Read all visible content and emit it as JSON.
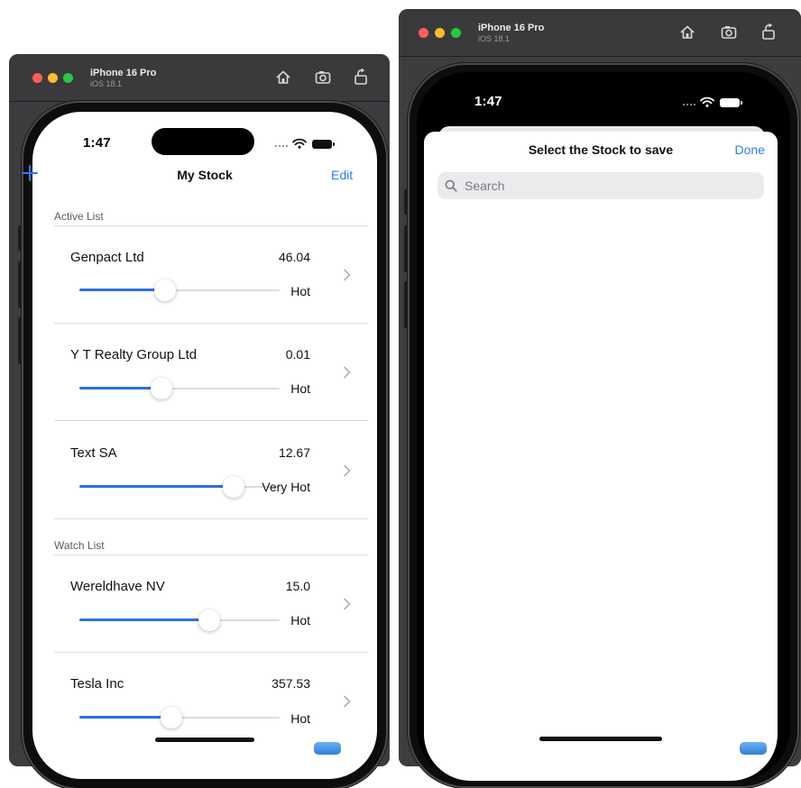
{
  "left_simulator": {
    "device_name": "iPhone 16 Pro",
    "os_version": "iOS 18.1",
    "toolbar_icons": [
      "home-icon",
      "screenshot-icon",
      "rotate-icon"
    ],
    "status_bar": {
      "time": "1:47",
      "icons": [
        "cellular-dots-icon",
        "wifi-icon",
        "battery-icon"
      ]
    },
    "nav": {
      "add_icon": "plus-icon",
      "title": "My Stock",
      "edit_label": "Edit"
    },
    "sections": [
      {
        "header": "Active List",
        "rows": [
          {
            "name": "Genpact Ltd",
            "value": "46.04",
            "level_label": "Hot",
            "slider_fraction": 0.43
          },
          {
            "name": "Y T Realty Group Ltd",
            "value": "0.01",
            "level_label": "Hot",
            "slider_fraction": 0.41
          },
          {
            "name": "Text SA",
            "value": "12.67",
            "level_label": "Very Hot",
            "slider_fraction": 0.77
          }
        ]
      },
      {
        "header": "Watch List",
        "rows": [
          {
            "name": "Wereldhave NV",
            "value": "15.0",
            "level_label": "Hot",
            "slider_fraction": 0.65
          },
          {
            "name": "Tesla Inc",
            "value": "357.53",
            "level_label": "Hot",
            "slider_fraction": 0.46
          }
        ]
      }
    ]
  },
  "right_simulator": {
    "device_name": "iPhone 16 Pro",
    "os_version": "iOS 18.1",
    "toolbar_icons": [
      "home-icon",
      "screenshot-icon",
      "rotate-icon"
    ],
    "status_bar": {
      "time": "1:47",
      "icons": [
        "cellular-dots-icon",
        "wifi-icon",
        "battery-icon"
      ]
    },
    "sheet": {
      "title": "Select the Stock to save",
      "done_label": "Done",
      "search_placeholder": "Search",
      "search_icon": "magnifying-glass-icon"
    }
  },
  "colors": {
    "accent": "#2b7cf5",
    "slider_fill": "#2b6fe8",
    "traffic_red": "#ff5f57",
    "traffic_yellow": "#febc2e",
    "traffic_green": "#28c840"
  }
}
